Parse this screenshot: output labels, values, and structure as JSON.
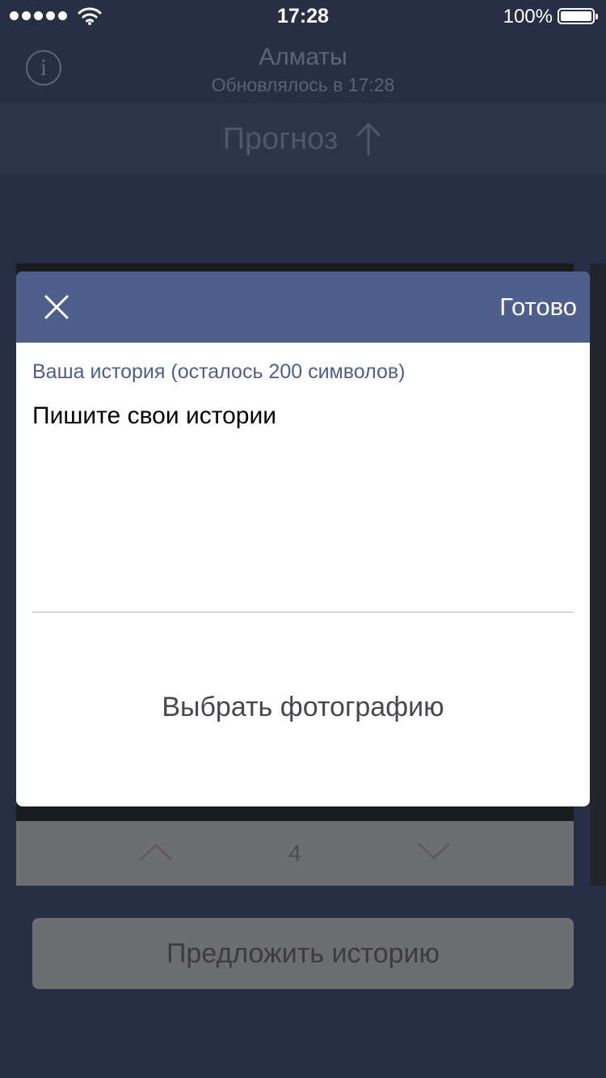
{
  "status_bar": {
    "time": "17:28",
    "battery_percent": "100%",
    "battery_level": 1.0,
    "signal_bars": 5
  },
  "header": {
    "city": "Алматы",
    "updated": "Обновлялось в 17:28",
    "info_icon": "i"
  },
  "forecast": {
    "label": "Прогноз",
    "icon": "arrow-up-icon"
  },
  "counter": {
    "value": "4"
  },
  "suggest_button": {
    "label": "Предложить историю"
  },
  "modal": {
    "close_icon": "close-icon",
    "done_label": "Готово",
    "story_label": "Ваша история (осталось 200 символов)",
    "story_placeholder": "Пишите свои истории",
    "story_value": "",
    "choose_photo_label": "Выбрать фотографию"
  },
  "colors": {
    "background": "#262f44",
    "modal_header": "#4f5f8c",
    "label_accent": "#4f5f8c"
  }
}
